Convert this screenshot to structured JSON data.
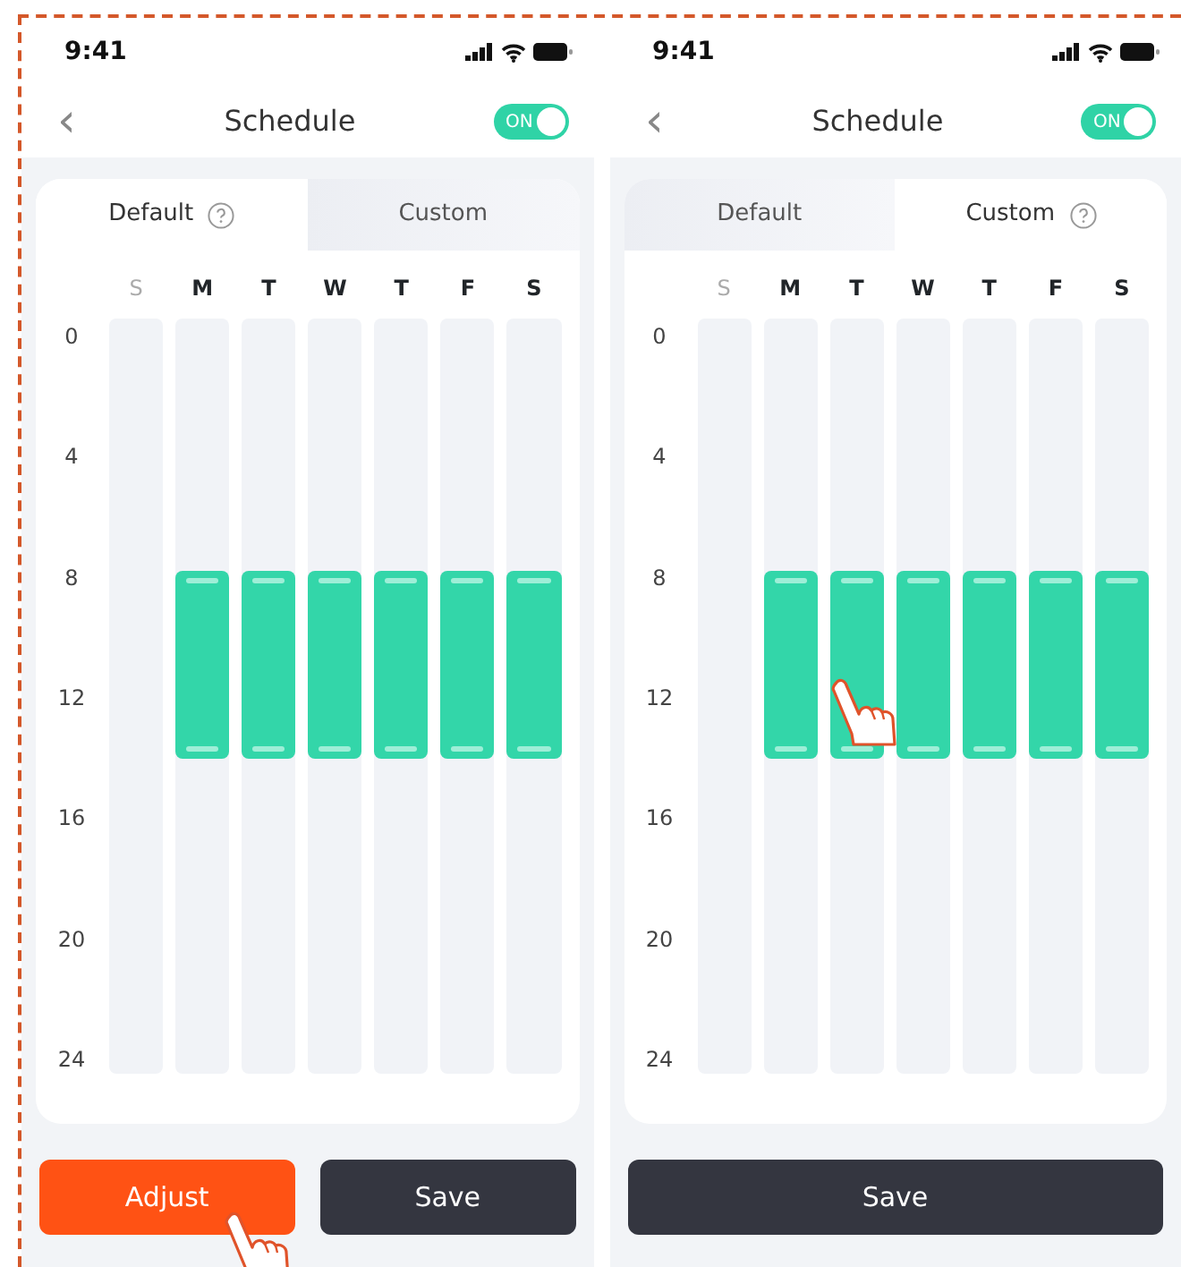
{
  "screens": [
    {
      "status_bar": {
        "time": "9:41"
      },
      "nav": {
        "back": "‹",
        "title": "Schedule",
        "toggle": {
          "label": "ON",
          "on": true
        }
      },
      "tabs": [
        {
          "label": "Default",
          "selected": true
        },
        {
          "label": "Custom",
          "selected": false
        }
      ],
      "hours": [
        "0",
        "4",
        "8",
        "12",
        "16",
        "20",
        "24"
      ],
      "days": [
        {
          "label": "S",
          "scheduled": false
        },
        {
          "label": "M",
          "scheduled": true
        },
        {
          "label": "T",
          "scheduled": true
        },
        {
          "label": "W",
          "scheduled": true
        },
        {
          "label": "T",
          "scheduled": true
        },
        {
          "label": "F",
          "scheduled": true
        },
        {
          "label": "S",
          "scheduled": true
        }
      ],
      "buttons": [
        {
          "label": "Adjust",
          "kind": "adjust"
        },
        {
          "label": "Save",
          "kind": "save"
        }
      ]
    },
    {
      "status_bar": {
        "time": "9:41"
      },
      "nav": {
        "back": "‹",
        "title": "Schedule",
        "toggle": {
          "label": "ON",
          "on": true
        }
      },
      "tabs": [
        {
          "label": "Default",
          "selected": false
        },
        {
          "label": "Custom",
          "selected": true
        }
      ],
      "hours": [
        "0",
        "4",
        "8",
        "12",
        "16",
        "20",
        "24"
      ],
      "days": [
        {
          "label": "S",
          "scheduled": false
        },
        {
          "label": "M",
          "scheduled": true
        },
        {
          "label": "T",
          "scheduled": true
        },
        {
          "label": "W",
          "scheduled": true
        },
        {
          "label": "T",
          "scheduled": true
        },
        {
          "label": "F",
          "scheduled": true
        },
        {
          "label": "S",
          "scheduled": true
        }
      ],
      "buttons": [
        {
          "label": "Save",
          "kind": "save"
        }
      ]
    }
  ]
}
